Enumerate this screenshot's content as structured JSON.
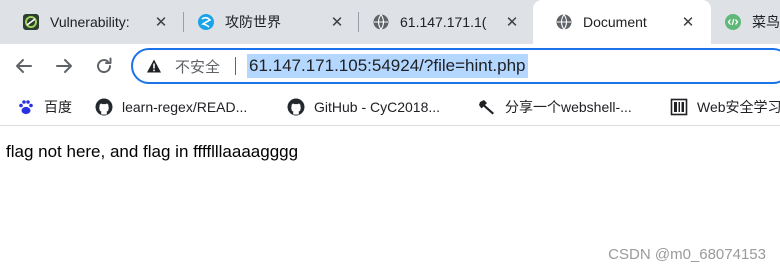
{
  "tabs": [
    {
      "title": "Vulnerability:",
      "icon": "vulnerability-favicon-icon",
      "active": false
    },
    {
      "title": "攻防世界",
      "icon": "adworld-favicon-icon",
      "active": false
    },
    {
      "title": "61.147.171.1(",
      "icon": "globe-icon",
      "active": false
    },
    {
      "title": "Document",
      "icon": "globe-icon",
      "active": true
    },
    {
      "title": "菜鸟",
      "icon": "runoob-favicon-icon",
      "active": false
    }
  ],
  "toolbar": {
    "insecure_label": "不安全",
    "url": "61.147.171.105:54924/?file=hint.php"
  },
  "bookmarks": [
    {
      "label": "百度",
      "icon": "baidu-paw-icon"
    },
    {
      "label": "learn-regex/READ...",
      "icon": "github-icon"
    },
    {
      "label": "GitHub - CyC2018...",
      "icon": "github-icon"
    },
    {
      "label": "分享一个webshell-...",
      "icon": "tool-icon"
    },
    {
      "label": "Web安全学习",
      "icon": "book-icon"
    }
  ],
  "page": {
    "text": "flag not here, and flag in fffflllaaaagggg"
  },
  "watermark": "CSDN @m0_68074153",
  "colors": {
    "tabstrip": "#dee1e6",
    "focus_ring": "#1a73e8",
    "url_selection": "#b4d7ff"
  }
}
